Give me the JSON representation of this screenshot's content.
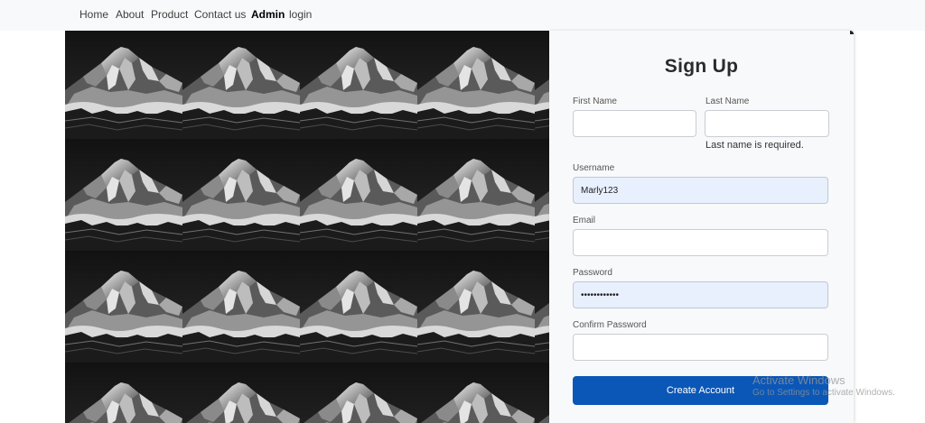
{
  "nav": {
    "items": [
      {
        "label": "Home"
      },
      {
        "label": "About"
      },
      {
        "label": "Product"
      },
      {
        "label": "Contact us"
      },
      {
        "label": "Admin",
        "active": true
      },
      {
        "label": "login"
      }
    ]
  },
  "hero": {
    "image": "mountain-peak-tiled-grayscale"
  },
  "form": {
    "title": "Sign Up",
    "first_name": {
      "label": "First Name",
      "value": ""
    },
    "last_name": {
      "label": "Last Name",
      "value": "",
      "error": "Last name is required."
    },
    "username": {
      "label": "Username",
      "value": "Marly123"
    },
    "email": {
      "label": "Email",
      "value": ""
    },
    "password": {
      "label": "Password",
      "value": "••••••••••••"
    },
    "confirm_password": {
      "label": "Confirm Password",
      "value": ""
    },
    "submit_label": "Create Account"
  },
  "watermark": {
    "line1": "Activate Windows",
    "line2": "Go to Settings to activate Windows."
  },
  "colors": {
    "button": "#0b57b7",
    "filled_field": "#e8f0fe",
    "navbar": "#f8f9fa"
  }
}
